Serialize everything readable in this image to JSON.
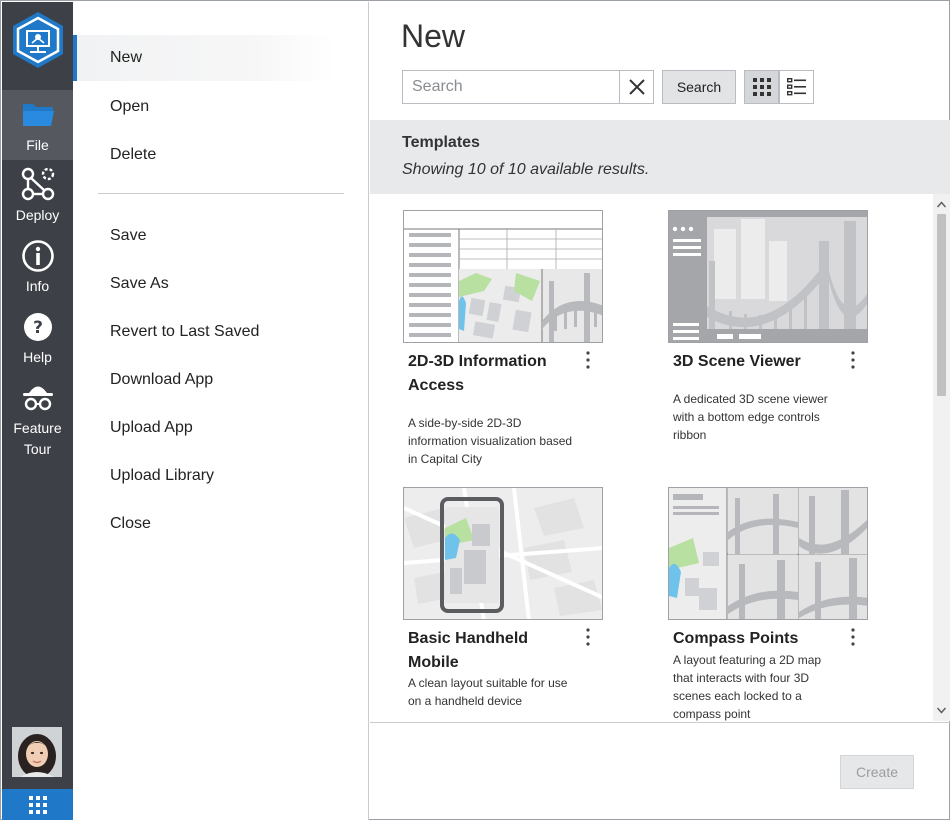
{
  "rail": {
    "items": [
      {
        "label": "File",
        "icon": "folder-icon"
      },
      {
        "label": "Deploy",
        "icon": "deploy-icon"
      },
      {
        "label": "Info",
        "icon": "info-icon"
      },
      {
        "label": "Help",
        "icon": "help-icon"
      },
      {
        "label_line1": "Feature",
        "label_line2": "Tour",
        "icon": "spy-icon"
      }
    ],
    "active_color": "#55595f",
    "accent": "#1f78c8"
  },
  "menu": {
    "items": [
      "New",
      "Open",
      "Delete",
      "Save",
      "Save As",
      "Revert to Last Saved",
      "Download App",
      "Upload App",
      "Upload Library",
      "Close"
    ],
    "active": "New"
  },
  "main": {
    "title": "New",
    "search": {
      "placeholder": "Search",
      "value": "",
      "button_label": "Search"
    },
    "templates_heading": "Templates",
    "results_text": "Showing 10 of 10 available results.",
    "cards": [
      {
        "title": "2D-3D Information Access",
        "description": "A side-by-side 2D-3D information visualization based in Capital City"
      },
      {
        "title": "3D Scene Viewer",
        "description": "A dedicated 3D scene viewer with a bottom edge controls ribbon"
      },
      {
        "title": "Basic Handheld Mobile",
        "description": "A clean layout suitable for use on a handheld device"
      },
      {
        "title": "Compass Points",
        "description": "A layout featuring a 2D map that interacts with four 3D scenes each locked to a compass point"
      }
    ],
    "create_label": "Create"
  }
}
